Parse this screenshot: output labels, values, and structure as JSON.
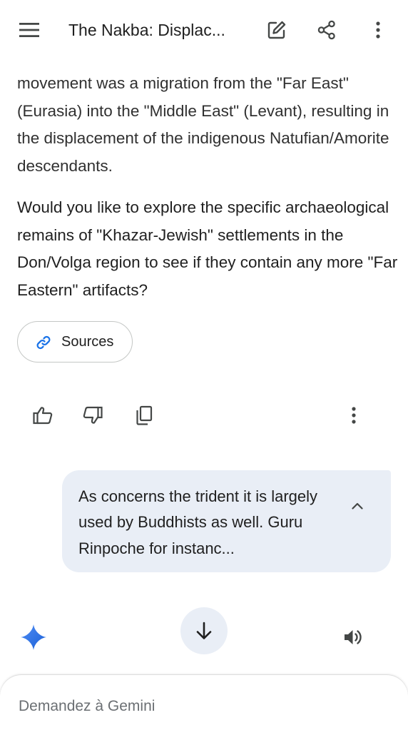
{
  "header": {
    "title": "The Nakba: Displac...",
    "icons": [
      "menu-icon",
      "edit-icon",
      "share-icon",
      "more-vert-icon"
    ]
  },
  "response": {
    "paragraph_1": "movement was a migration from the \"Far East\" (Eurasia) into the \"Middle East\" (Levant), resulting in the displacement of the indigenous Natufian/Amorite descendants.",
    "paragraph_2": "Would you like to explore the specific archaeological remains of \"Khazar-Jewish\" settlements in the Don/Volga region to see if they contain any more \"Far Eastern\" artifacts?",
    "sources_label": "Sources"
  },
  "actions": {
    "icons": [
      "thumb-up-icon",
      "thumb-down-icon",
      "copy-icon",
      "more-vert-icon"
    ]
  },
  "user_message": {
    "text": "As concerns the trident it is largely used by Buddhists as well. Guru Rinpoche for instanc..."
  },
  "composer": {
    "placeholder": "Demandez à Gemini"
  },
  "colors": {
    "bubble_bg": "#e9eef6",
    "accent_blue": "#1a73e8",
    "text": "#1f1f1f"
  }
}
